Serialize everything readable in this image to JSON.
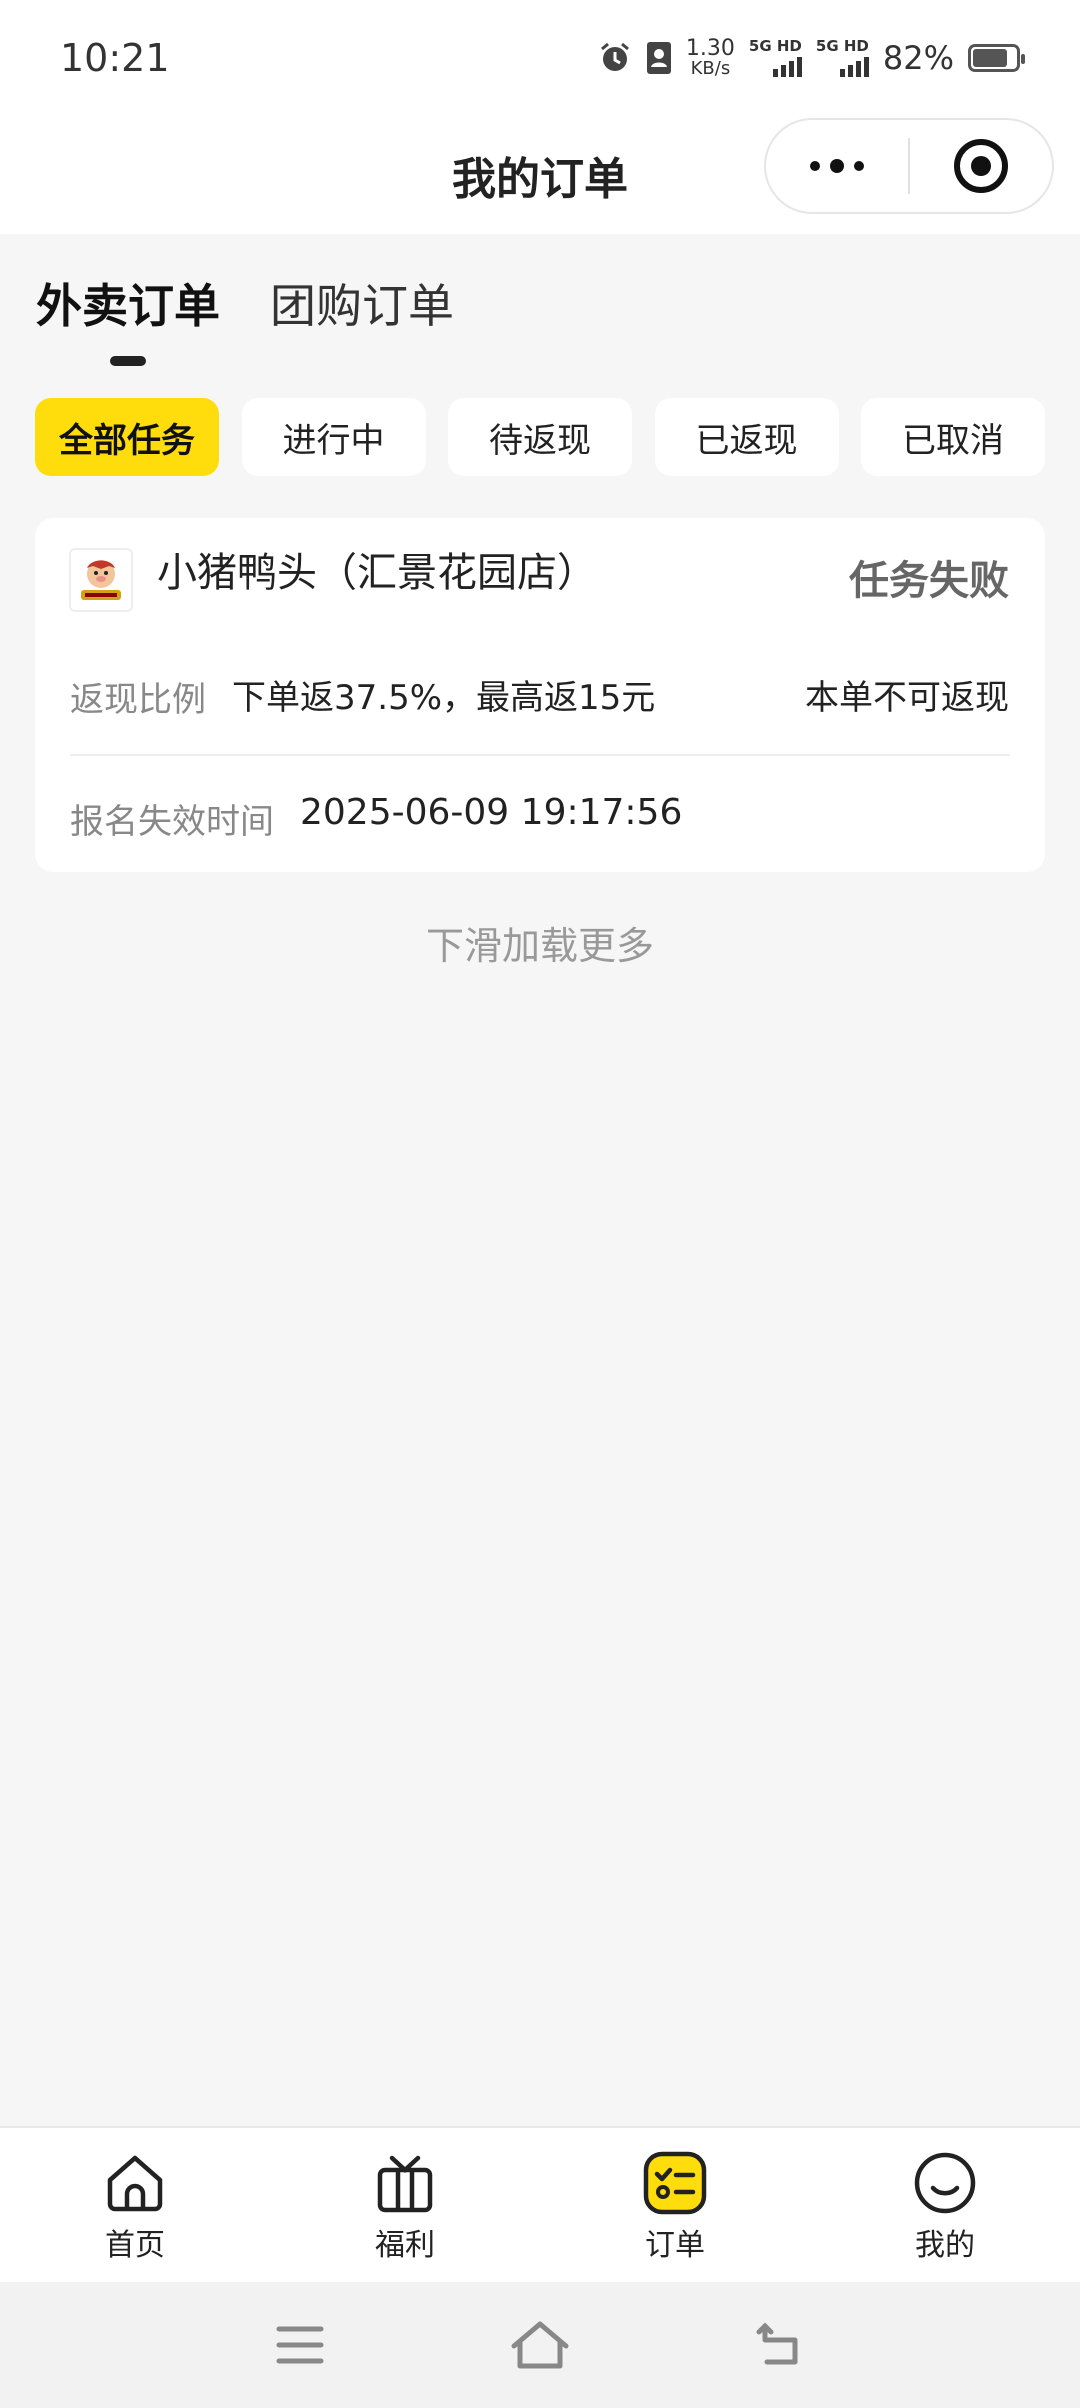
{
  "status_bar": {
    "time": "10:21",
    "net_speed_value": "1.30",
    "net_speed_unit": "KB/s",
    "sim1_label": "5G HD",
    "sim2_label": "5G HD",
    "battery_percent": "82%",
    "battery_level": 0.82,
    "icons": [
      "alarm-icon",
      "contact-card-icon",
      "signal-icon",
      "battery-icon"
    ]
  },
  "header": {
    "title": "我的订单",
    "capsule_icons": [
      "more-dots-icon",
      "close-target-icon"
    ]
  },
  "main_tabs": [
    {
      "label": "外卖订单",
      "active": true
    },
    {
      "label": "团购订单",
      "active": false
    }
  ],
  "filter_chips": [
    {
      "label": "全部任务",
      "active": true
    },
    {
      "label": "进行中",
      "active": false
    },
    {
      "label": "待返现",
      "active": false
    },
    {
      "label": "已返现",
      "active": false
    },
    {
      "label": "已取消",
      "active": false
    }
  ],
  "orders": [
    {
      "shop_name": "小猪鸭头（汇景花园店）",
      "status": "任务失败",
      "cashback_label": "返现比例",
      "cashback_value": "下单返37.5%，最高返15元",
      "cashback_note": "本单不可返现",
      "expire_label": "报名失效时间",
      "expire_value": "2025-06-09 19:17:56"
    }
  ],
  "load_more_text": "下滑加载更多",
  "bottom_nav": [
    {
      "label": "首页",
      "icon": "home-icon",
      "active": false
    },
    {
      "label": "福利",
      "icon": "gift-icon",
      "active": false
    },
    {
      "label": "订单",
      "icon": "order-list-icon",
      "active": true
    },
    {
      "label": "我的",
      "icon": "smile-face-icon",
      "active": false
    }
  ],
  "system_nav": [
    "menu-icon",
    "home-outline-icon",
    "back-icon"
  ],
  "colors": {
    "accent": "#ffdd0d",
    "background": "#f6f6f6",
    "card": "#ffffff",
    "muted_text": "#888888"
  }
}
